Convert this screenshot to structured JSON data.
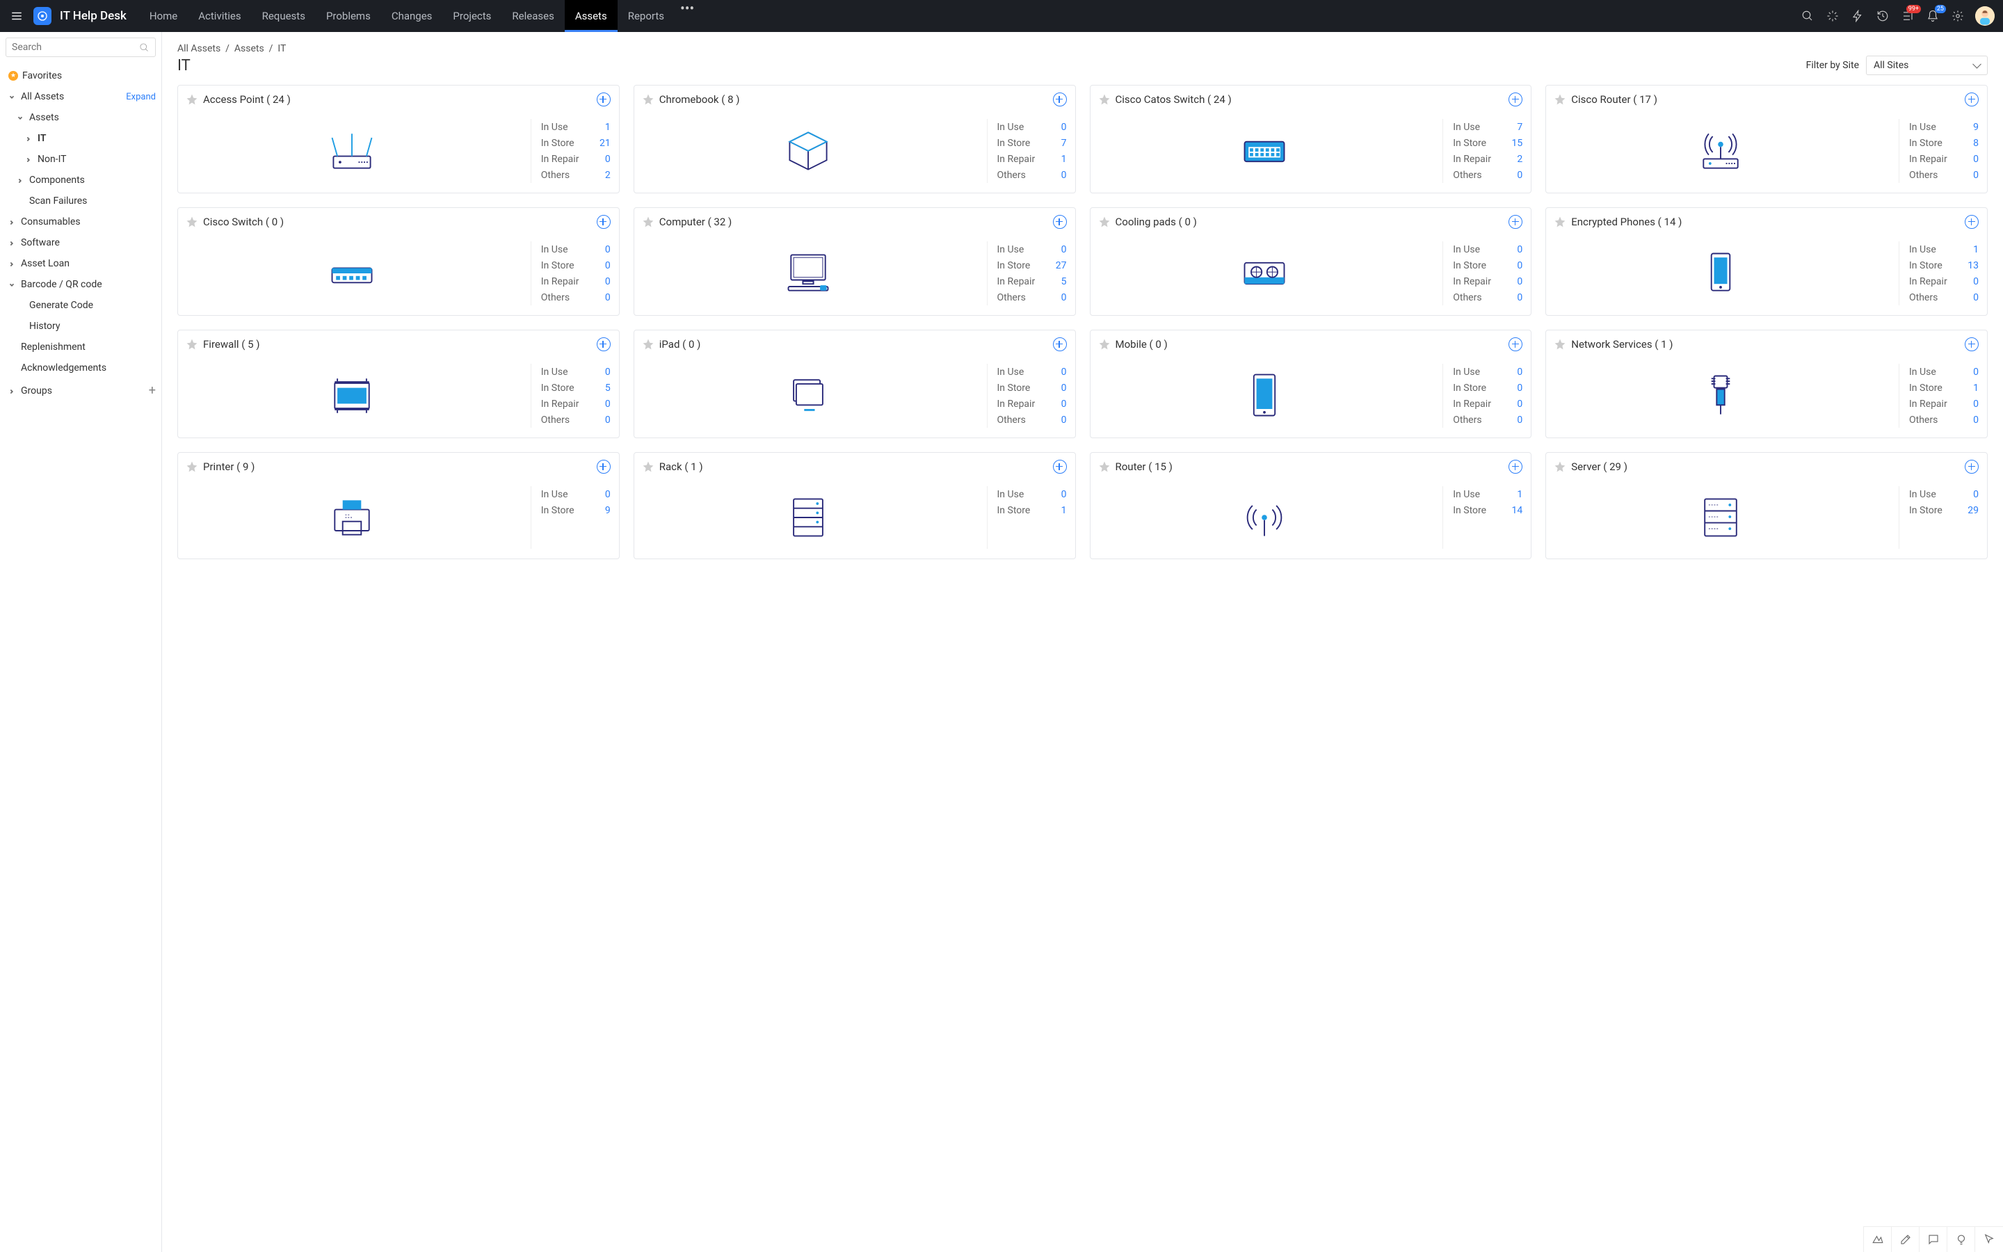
{
  "app_title": "IT Help Desk",
  "nav": [
    "Home",
    "Activities",
    "Requests",
    "Problems",
    "Changes",
    "Projects",
    "Releases",
    "Assets",
    "Reports"
  ],
  "nav_active": "Assets",
  "notif_badge": "99+",
  "bell_badge": "25",
  "sidebar": {
    "search_placeholder": "Search",
    "favorites": "Favorites",
    "all_assets": "All Assets",
    "expand": "Expand",
    "assets": "Assets",
    "it": "IT",
    "non_it": "Non-IT",
    "components": "Components",
    "scan_failures": "Scan Failures",
    "consumables": "Consumables",
    "software": "Software",
    "asset_loan": "Asset Loan",
    "barcode": "Barcode / QR code",
    "generate_code": "Generate Code",
    "history": "History",
    "replenishment": "Replenishment",
    "acknowledgements": "Acknowledgements",
    "groups": "Groups"
  },
  "breadcrumb": [
    "All Assets",
    "Assets",
    "IT"
  ],
  "page_title": "IT",
  "filter_label": "Filter by Site",
  "site_selected": "All Sites",
  "stat_labels": [
    "In Use",
    "In Store",
    "In Repair",
    "Others"
  ],
  "cards": [
    {
      "name": "Access Point",
      "count": 24,
      "icon": "access-point",
      "stats": [
        1,
        21,
        0,
        2
      ]
    },
    {
      "name": "Chromebook",
      "count": 8,
      "icon": "cube",
      "stats": [
        0,
        7,
        1,
        0
      ]
    },
    {
      "name": "Cisco Catos Switch",
      "count": 24,
      "icon": "switch-blue",
      "stats": [
        7,
        15,
        2,
        0
      ]
    },
    {
      "name": "Cisco Router",
      "count": 17,
      "icon": "router",
      "stats": [
        9,
        8,
        0,
        0
      ]
    },
    {
      "name": "Cisco Switch",
      "count": 0,
      "icon": "switch-small",
      "stats": [
        0,
        0,
        0,
        0
      ]
    },
    {
      "name": "Computer",
      "count": 32,
      "icon": "computer",
      "stats": [
        0,
        27,
        5,
        0
      ]
    },
    {
      "name": "Cooling pads",
      "count": 0,
      "icon": "cooling",
      "stats": [
        0,
        0,
        0,
        0
      ]
    },
    {
      "name": "Encrypted Phones",
      "count": 14,
      "icon": "phone",
      "stats": [
        1,
        13,
        0,
        0
      ]
    },
    {
      "name": "Firewall",
      "count": 5,
      "icon": "firewall",
      "stats": [
        0,
        5,
        0,
        0
      ]
    },
    {
      "name": "iPad",
      "count": 0,
      "icon": "ipad",
      "stats": [
        0,
        0,
        0,
        0
      ]
    },
    {
      "name": "Mobile",
      "count": 0,
      "icon": "mobile",
      "stats": [
        0,
        0,
        0,
        0
      ]
    },
    {
      "name": "Network Services",
      "count": 1,
      "icon": "cable",
      "stats": [
        0,
        1,
        0,
        0
      ]
    },
    {
      "name": "Printer",
      "count": 9,
      "icon": "printer",
      "stats": [
        0,
        9
      ]
    },
    {
      "name": "Rack",
      "count": 1,
      "icon": "rack",
      "stats": [
        0,
        1
      ]
    },
    {
      "name": "Router",
      "count": 15,
      "icon": "router2",
      "stats": [
        1,
        14
      ]
    },
    {
      "name": "Server",
      "count": 29,
      "icon": "server",
      "stats": [
        0,
        29
      ]
    }
  ]
}
